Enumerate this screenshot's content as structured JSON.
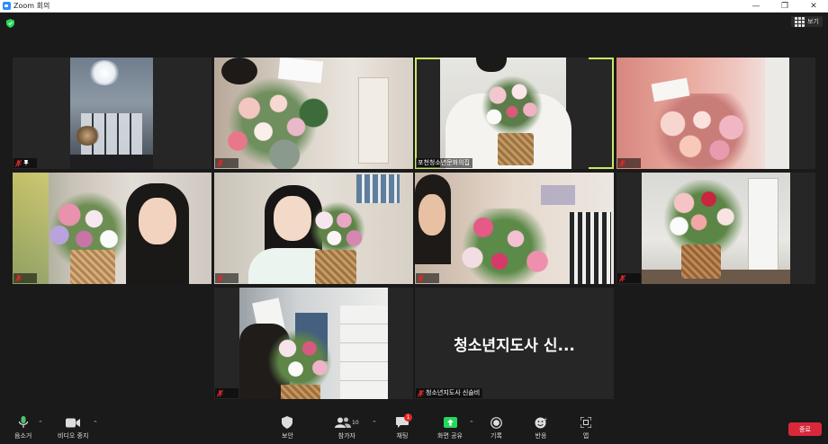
{
  "window": {
    "title": "Zoom 회의"
  },
  "header": {
    "view_label": "보기"
  },
  "tiles": [
    {
      "id": "t1",
      "name": "",
      "muted": true,
      "pinned": true,
      "active": false
    },
    {
      "id": "t2",
      "name": "",
      "muted": true,
      "pinned": false,
      "active": false
    },
    {
      "id": "t3",
      "name": "포천청소년문화의집",
      "muted": false,
      "pinned": false,
      "active": true
    },
    {
      "id": "t4",
      "name": "",
      "muted": true,
      "pinned": false,
      "active": false
    },
    {
      "id": "t5",
      "name": "",
      "muted": true,
      "pinned": false,
      "active": false
    },
    {
      "id": "t6",
      "name": "",
      "muted": true,
      "pinned": false,
      "active": false
    },
    {
      "id": "t7",
      "name": "",
      "muted": true,
      "pinned": false,
      "active": false
    },
    {
      "id": "t8",
      "name": "",
      "muted": true,
      "pinned": false,
      "active": false
    },
    {
      "id": "t9",
      "name": "",
      "muted": true,
      "pinned": false,
      "active": false
    },
    {
      "id": "t10",
      "name": "청소년지도사 신슬비",
      "muted": true,
      "pinned": false,
      "active": false,
      "display_name": "청소년지도사 신..."
    }
  ],
  "toolbar": {
    "mute": "음소거",
    "video": "비디오 중지",
    "security": "보안",
    "participants": "참가자",
    "participants_count": "10",
    "chat": "채팅",
    "chat_badge": "1",
    "share": "화면 공유",
    "record": "기록",
    "reactions": "반응",
    "apps": "앱",
    "end": "종료"
  },
  "colors": {
    "active_speaker": "#c9e86a",
    "share_green": "#23d959",
    "end_red": "#d9283c",
    "mic_off_red": "#e02828",
    "shield_green": "#23d959"
  }
}
